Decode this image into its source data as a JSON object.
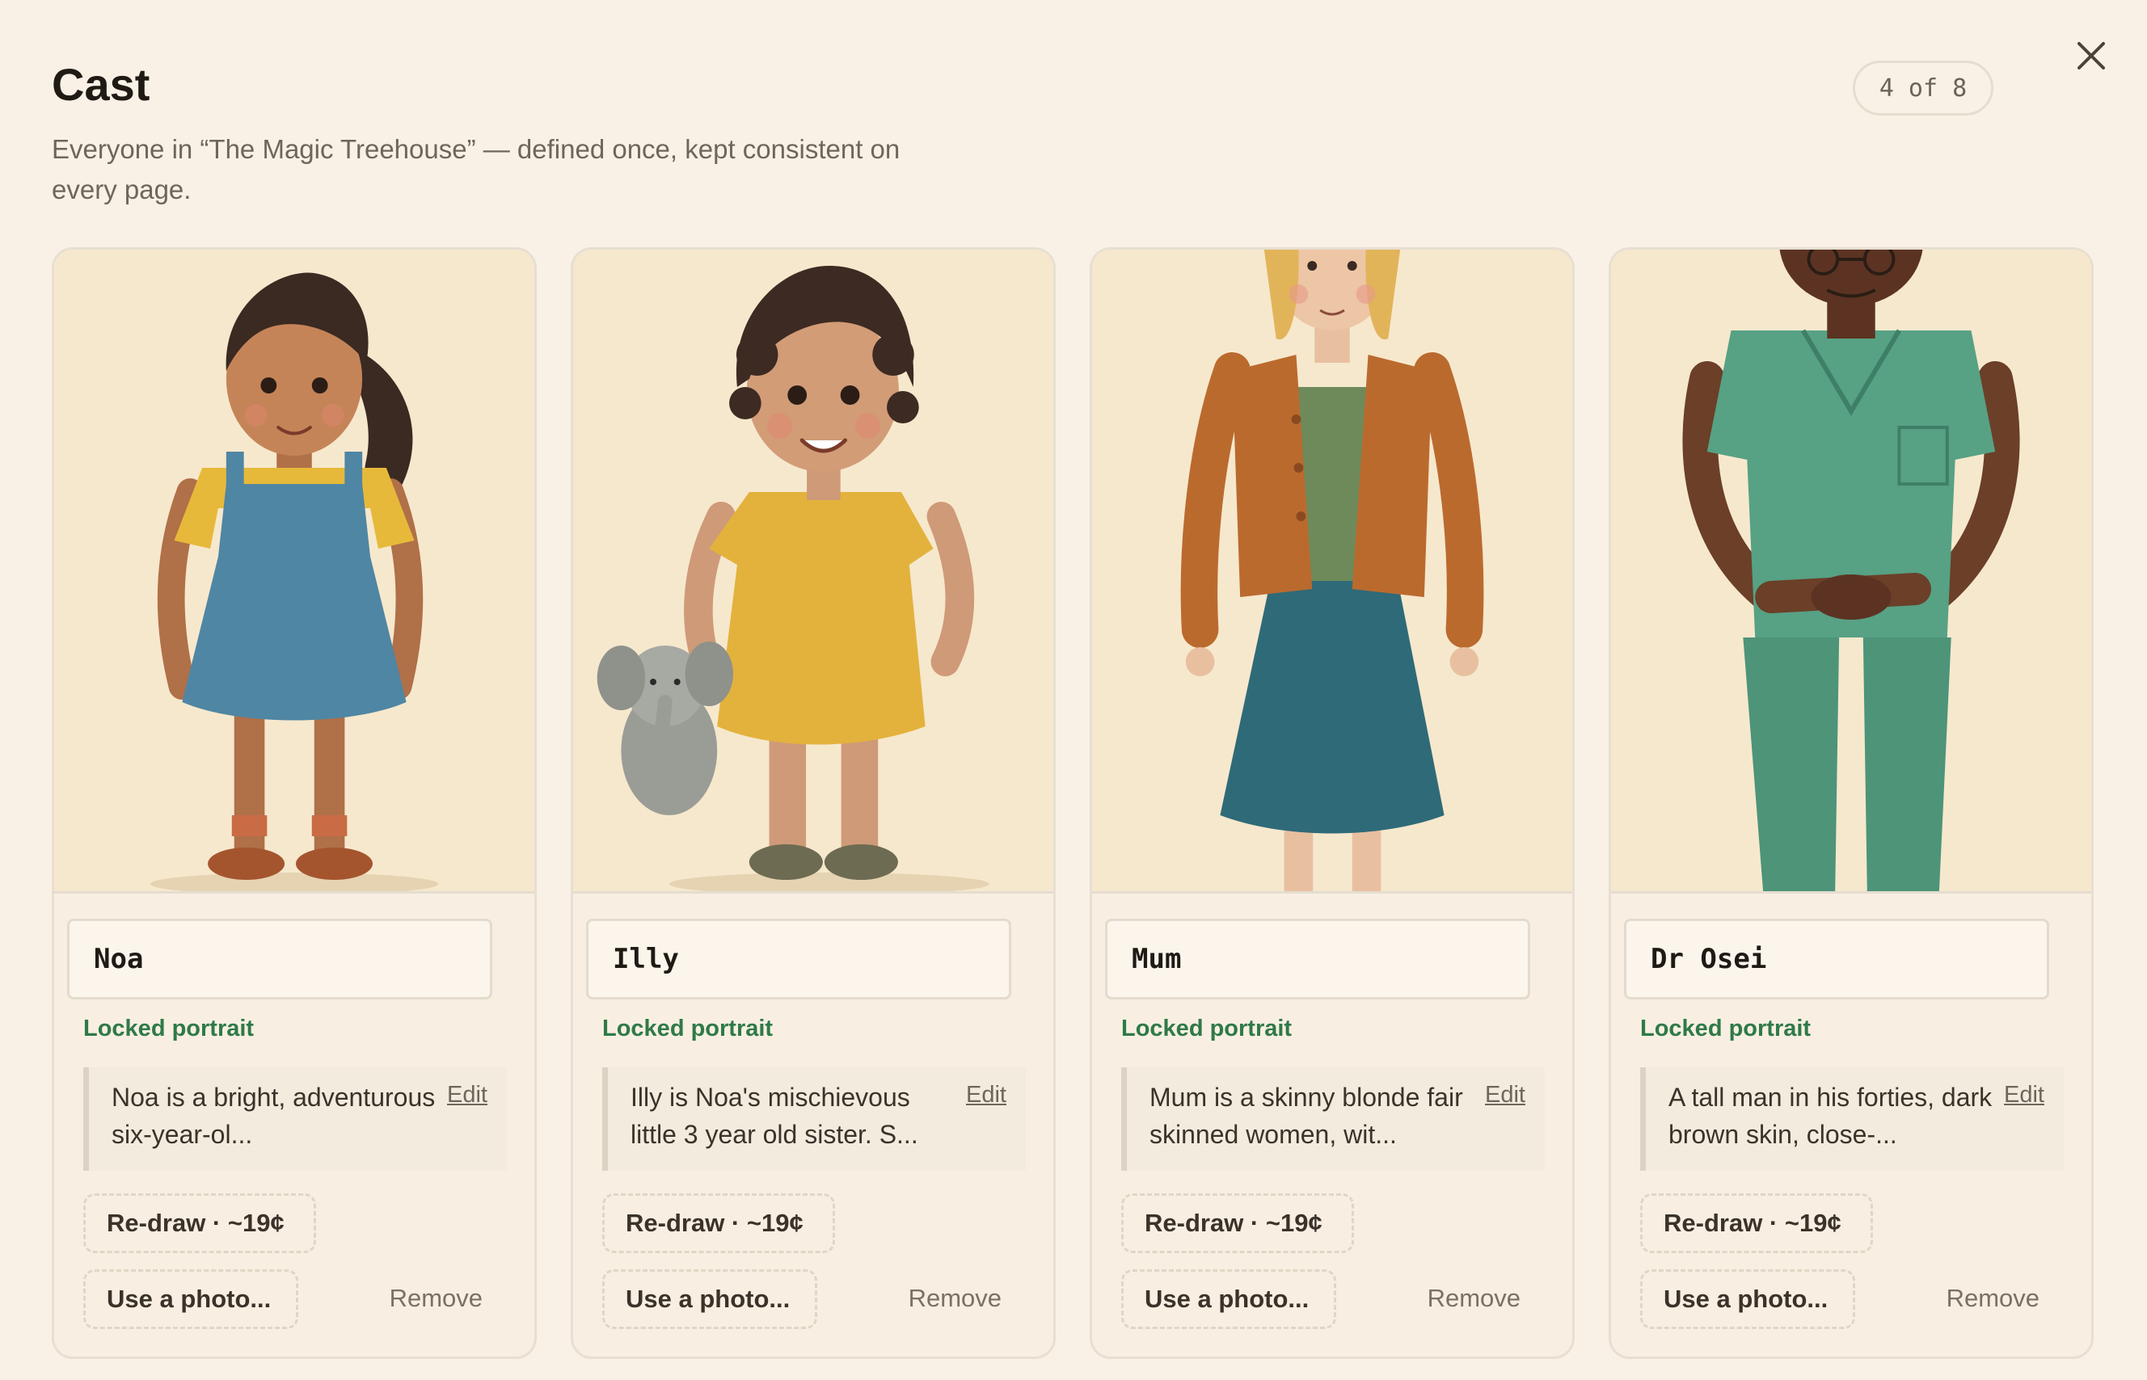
{
  "header": {
    "title": "Cast",
    "subtitle": "Everyone in “The Magic Treehouse” — defined once, kept consistent on every page.",
    "counter": "4 of 8"
  },
  "icons": {
    "close": "close-icon"
  },
  "cards": [
    {
      "name": "Noa",
      "status": "Locked portrait",
      "description": "Noa is a bright, adventurous six-year-ol...",
      "edit_label": "Edit",
      "redraw_label": "Re-draw · ~19¢",
      "photo_label": "Use a photo...",
      "remove_label": "Remove",
      "portrait": "girl-in-blue-pinafore-illustration"
    },
    {
      "name": "Illy",
      "status": "Locked portrait",
      "description": "Illy is Noa's mischievous little 3 year old sister. S...",
      "edit_label": "Edit",
      "redraw_label": "Re-draw · ~19¢",
      "photo_label": "Use a photo...",
      "remove_label": "Remove",
      "portrait": "toddler-in-yellow-dress-with-elephant-illustration"
    },
    {
      "name": "Mum",
      "status": "Locked portrait",
      "description": "Mum is a skinny blonde fair skinned women, wit...",
      "edit_label": "Edit",
      "redraw_label": "Re-draw · ~19¢",
      "photo_label": "Use a photo...",
      "remove_label": "Remove",
      "portrait": "woman-in-orange-cardigan-illustration"
    },
    {
      "name": "Dr Osei",
      "status": "Locked portrait",
      "description": "A tall man in his forties, dark brown skin, close-...",
      "edit_label": "Edit",
      "redraw_label": "Re-draw · ~19¢",
      "photo_label": "Use a photo...",
      "remove_label": "Remove",
      "portrait": "man-in-green-scrubs-illustration"
    }
  ],
  "colors": {
    "background": "#f9f1e5",
    "locked_green": "#2f7a48",
    "border": "#e7dfd2"
  }
}
